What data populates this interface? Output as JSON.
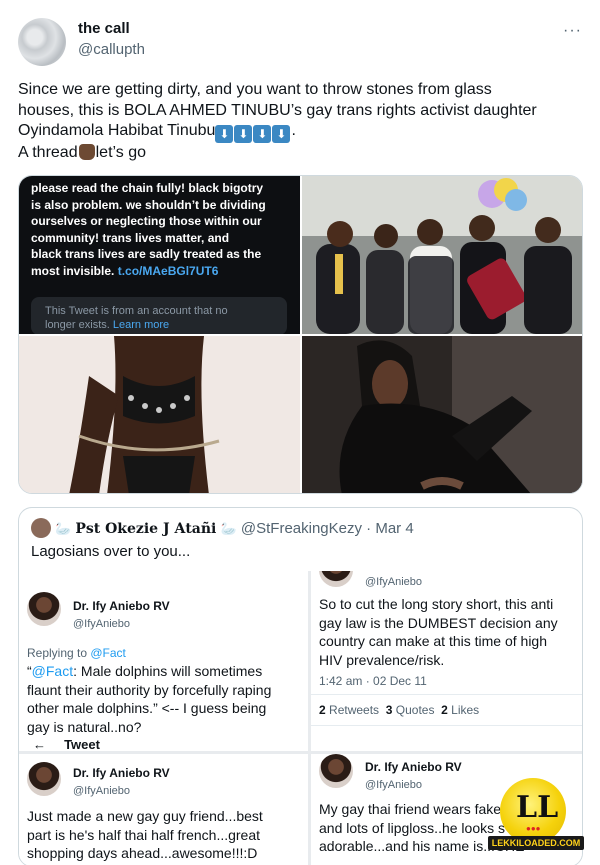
{
  "author": {
    "display_name": "the call",
    "handle": "@callupth",
    "avatar_icon": "cloud-avatar",
    "more_icon": "more-dots-icon",
    "more_label": "···"
  },
  "tweet": {
    "lines": [
      "Since we are getting dirty, and you want to throw stones from glass",
      "houses, this is BOLA AHMED TINUBU’s gay trans  rights activist daughter",
      "Oyindamola Habibat Tinubu",
      "."
    ],
    "thread_prefix": "A thread",
    "thread_suffix": "let’s go",
    "arrow_glyph": "⬇"
  },
  "media": {
    "screenshot_quote": {
      "lines": [
        "please read the chain fully! black bigotry",
        "is also problem. we shouldn’t be dividing",
        "ourselves or neglecting those within our",
        "community! trans lives matter, and",
        "black trans lives are sadly treated as the",
        "most invisible. "
      ],
      "link": "t.co/MAeBGl7UT6",
      "notice_text": "This Tweet is from an account that no",
      "notice_text_2": "longer exists. ",
      "learn_more": "Learn more"
    }
  },
  "quoted": {
    "display_name": "𝐏𝐬𝐭 𝐎𝐤𝐞𝐳𝐢𝐞 𝐉 𝐀𝐭𝐚ñ𝐢",
    "badge": "🦢",
    "handle": "@StFreakingKezy",
    "separator": "·",
    "date": "Mar 4",
    "text": "Lagosians over to you...",
    "screens": {
      "s1": {
        "name": "Dr. Ify Aniebo RV",
        "handle": "@IfyAniebo",
        "replying_to": "Replying to ",
        "mention": "@Fact",
        "body_prefix": "“",
        "body_lines": [
          ": Male dolphins will sometimes",
          "flaunt their authority by forcefully raping",
          "other male dolphins.” <-- I guess being",
          "gay is natural..no?"
        ],
        "cut_label": "Tweet"
      },
      "s2": {
        "handle": "@IfyAniebo",
        "body_lines": [
          "So to cut the long story short, this anti",
          "gay law is the DUMBEST decision any",
          "country can make at this time of high",
          "HIV prevalence/risk."
        ],
        "timestamp": "1:42 am · 02 Dec 11",
        "retweets_count": "2",
        "retweets_label": "Retweets",
        "quotes_count": "3",
        "quotes_label": "Quotes",
        "likes_count": "2",
        "likes_label": "Likes"
      },
      "s3": {
        "name": "Dr. Ify Aniebo RV",
        "handle": "@IfyAniebo",
        "body_lines": [
          "Just made a new gay guy friend...best",
          "part is he's half thai half french...great",
          "shopping days ahead...awesome!!!:D"
        ]
      },
      "s4": {
        "name": "Dr. Ify Aniebo RV",
        "handle": "@IfyAniebo",
        "body_lines": [
          "My gay thai friend wears fake",
          "and lots of lipgloss..he looks s",
          "adorable...and his name is...CHE"
        ]
      }
    }
  },
  "watermark": {
    "letters": "LL",
    "site": "LEKKILOADED.COM"
  }
}
